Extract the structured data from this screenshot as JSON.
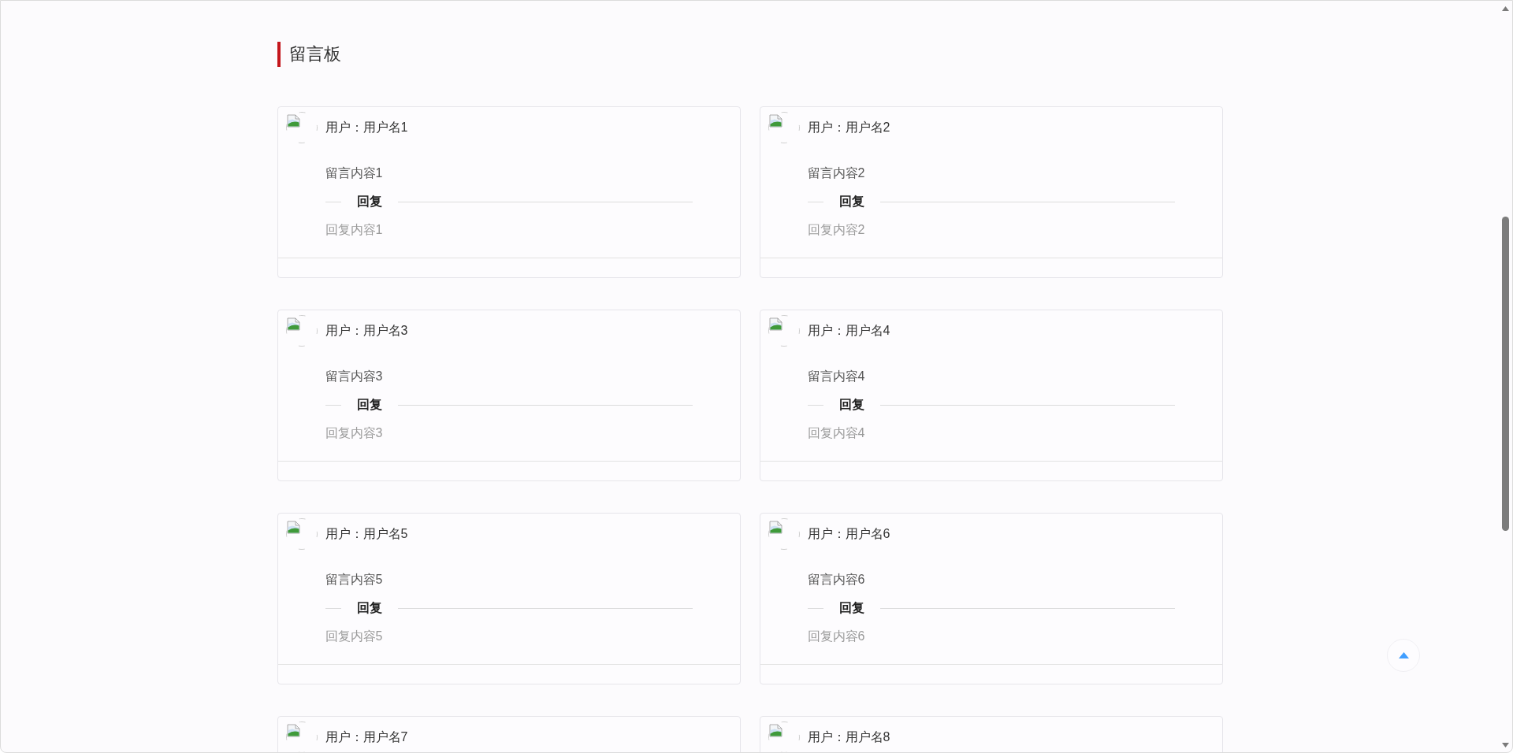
{
  "title": "留言板",
  "messages": [
    {
      "user": "用户：用户名1",
      "message": "留言内容1",
      "reply_heading": "回复",
      "reply": "回复内容1"
    },
    {
      "user": "用户：用户名2",
      "message": "留言内容2",
      "reply_heading": "回复",
      "reply": "回复内容2"
    },
    {
      "user": "用户：用户名3",
      "message": "留言内容3",
      "reply_heading": "回复",
      "reply": "回复内容3"
    },
    {
      "user": "用户：用户名4",
      "message": "留言内容4",
      "reply_heading": "回复",
      "reply": "回复内容4"
    },
    {
      "user": "用户：用户名5",
      "message": "留言内容5",
      "reply_heading": "回复",
      "reply": "回复内容5"
    },
    {
      "user": "用户：用户名6",
      "message": "留言内容6",
      "reply_heading": "回复",
      "reply": "回复内容6"
    },
    {
      "user": "用户：用户名7"
    },
    {
      "user": "用户：用户名8"
    }
  ]
}
